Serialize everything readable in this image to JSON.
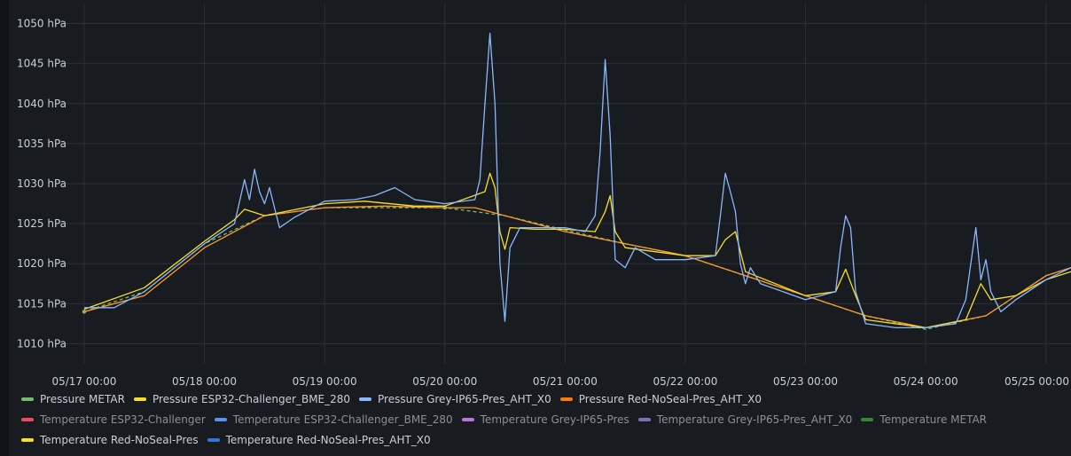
{
  "chart_data": {
    "type": "line",
    "y_unit": "hPa",
    "ylim": [
      1007.5,
      1052.5
    ],
    "y_ticks": [
      "1010 hPa",
      "1015 hPa",
      "1020 hPa",
      "1025 hPa",
      "1030 hPa",
      "1035 hPa",
      "1040 hPa",
      "1045 hPa",
      "1050 hPa"
    ],
    "y_tick_values": [
      1010,
      1015,
      1020,
      1025,
      1030,
      1035,
      1040,
      1045,
      1050
    ],
    "x_range": [
      "2024-05-16T21:00",
      "2024-05-25T05:00"
    ],
    "x_ticks": [
      "05/17 00:00",
      "05/18 00:00",
      "05/19 00:00",
      "05/20 00:00",
      "05/21 00:00",
      "05/22 00:00",
      "05/23 00:00",
      "05/24 00:00",
      "05/25 00:00"
    ],
    "grid": true,
    "legend_position": "bottom",
    "series": [
      {
        "name": "Pressure METAR",
        "color": "#73bf69",
        "style": "dashed",
        "points": [
          [
            "2024-05-17T00:00",
            1014.0
          ],
          [
            "2024-05-17T12:00",
            1016.5
          ],
          [
            "2024-05-18T00:00",
            1022.5
          ],
          [
            "2024-05-18T12:00",
            1026.0
          ],
          [
            "2024-05-19T00:00",
            1027.0
          ],
          [
            "2024-05-19T12:00",
            1027.0
          ],
          [
            "2024-05-20T00:00",
            1027.0
          ],
          [
            "2024-05-20T12:00",
            1026.0
          ],
          [
            "2024-05-21T00:00",
            1024.2
          ],
          [
            "2024-05-21T12:00",
            1022.5
          ],
          [
            "2024-05-22T00:00",
            1021.0
          ],
          [
            "2024-05-22T12:00",
            1018.5
          ],
          [
            "2024-05-23T00:00",
            1016.0
          ],
          [
            "2024-05-23T12:00",
            1013.5
          ],
          [
            "2024-05-24T00:00",
            1011.8
          ],
          [
            "2024-05-24T12:00",
            1013.5
          ],
          [
            "2024-05-25T00:00",
            1018.5
          ],
          [
            "2024-05-25T05:00",
            1019.5
          ]
        ]
      },
      {
        "name": "Pressure ESP32-Challenger_BME_280",
        "color": "#fade2a",
        "style": "solid",
        "points": [
          [
            "2024-05-17T00:00",
            1014.3
          ],
          [
            "2024-05-17T12:00",
            1017.0
          ],
          [
            "2024-05-18T00:00",
            1022.8
          ],
          [
            "2024-05-18T06:00",
            1025.5
          ],
          [
            "2024-05-18T08:00",
            1026.8
          ],
          [
            "2024-05-18T12:00",
            1026.0
          ],
          [
            "2024-05-19T00:00",
            1027.5
          ],
          [
            "2024-05-19T08:00",
            1027.8
          ],
          [
            "2024-05-19T18:00",
            1027.2
          ],
          [
            "2024-05-20T00:00",
            1027.2
          ],
          [
            "2024-05-20T08:00",
            1029.0
          ],
          [
            "2024-05-20T09:00",
            1031.3
          ],
          [
            "2024-05-20T10:00",
            1029.5
          ],
          [
            "2024-05-20T11:00",
            1024.0
          ],
          [
            "2024-05-20T12:00",
            1021.8
          ],
          [
            "2024-05-20T13:00",
            1024.5
          ],
          [
            "2024-05-20T18:00",
            1024.3
          ],
          [
            "2024-05-21T00:00",
            1024.3
          ],
          [
            "2024-05-21T06:00",
            1024.0
          ],
          [
            "2024-05-21T08:00",
            1026.5
          ],
          [
            "2024-05-21T09:00",
            1028.5
          ],
          [
            "2024-05-21T10:00",
            1024.0
          ],
          [
            "2024-05-21T12:00",
            1022.0
          ],
          [
            "2024-05-21T18:00",
            1021.5
          ],
          [
            "2024-05-22T00:00",
            1021.0
          ],
          [
            "2024-05-22T06:00",
            1021.0
          ],
          [
            "2024-05-22T08:00",
            1023.0
          ],
          [
            "2024-05-22T10:00",
            1024.0
          ],
          [
            "2024-05-22T12:00",
            1019.0
          ],
          [
            "2024-05-22T14:00",
            1018.5
          ],
          [
            "2024-05-23T00:00",
            1016.0
          ],
          [
            "2024-05-23T06:00",
            1016.5
          ],
          [
            "2024-05-23T08:00",
            1019.3
          ],
          [
            "2024-05-23T10:00",
            1016.0
          ],
          [
            "2024-05-23T12:00",
            1013.0
          ],
          [
            "2024-05-24T00:00",
            1012.0
          ],
          [
            "2024-05-24T08:00",
            1013.0
          ],
          [
            "2024-05-24T10:00",
            1016.0
          ],
          [
            "2024-05-24T11:00",
            1017.5
          ],
          [
            "2024-05-24T13:00",
            1015.5
          ],
          [
            "2024-05-24T18:00",
            1016.0
          ],
          [
            "2024-05-25T00:00",
            1018.0
          ],
          [
            "2024-05-25T05:00",
            1019.0
          ]
        ]
      },
      {
        "name": "Pressure Grey-IP65-Pres_AHT_X0",
        "color": "#8ab8ff",
        "style": "solid",
        "points": [
          [
            "2024-05-17T00:00",
            1014.5
          ],
          [
            "2024-05-17T06:00",
            1014.5
          ],
          [
            "2024-05-17T12:00",
            1016.5
          ],
          [
            "2024-05-18T00:00",
            1022.5
          ],
          [
            "2024-05-18T06:00",
            1025.0
          ],
          [
            "2024-05-18T08:00",
            1030.5
          ],
          [
            "2024-05-18T09:00",
            1028.0
          ],
          [
            "2024-05-18T10:00",
            1031.8
          ],
          [
            "2024-05-18T11:00",
            1029.0
          ],
          [
            "2024-05-18T12:00",
            1027.5
          ],
          [
            "2024-05-18T13:00",
            1029.5
          ],
          [
            "2024-05-18T14:00",
            1027.0
          ],
          [
            "2024-05-18T15:00",
            1024.5
          ],
          [
            "2024-05-18T18:00",
            1025.8
          ],
          [
            "2024-05-19T00:00",
            1027.8
          ],
          [
            "2024-05-19T06:00",
            1028.0
          ],
          [
            "2024-05-19T10:00",
            1028.5
          ],
          [
            "2024-05-19T14:00",
            1029.5
          ],
          [
            "2024-05-19T18:00",
            1028.0
          ],
          [
            "2024-05-20T00:00",
            1027.5
          ],
          [
            "2024-05-20T06:00",
            1028.0
          ],
          [
            "2024-05-20T07:00",
            1030.5
          ],
          [
            "2024-05-20T08:00",
            1040.0
          ],
          [
            "2024-05-20T09:00",
            1048.8
          ],
          [
            "2024-05-20T10:00",
            1040.0
          ],
          [
            "2024-05-20T11:00",
            1020.0
          ],
          [
            "2024-05-20T12:00",
            1012.8
          ],
          [
            "2024-05-20T13:00",
            1022.0
          ],
          [
            "2024-05-20T15:00",
            1024.5
          ],
          [
            "2024-05-20T18:00",
            1024.5
          ],
          [
            "2024-05-21T00:00",
            1024.5
          ],
          [
            "2024-05-21T04:00",
            1024.0
          ],
          [
            "2024-05-21T06:00",
            1026.0
          ],
          [
            "2024-05-21T07:00",
            1034.0
          ],
          [
            "2024-05-21T08:00",
            1045.5
          ],
          [
            "2024-05-21T09:00",
            1036.0
          ],
          [
            "2024-05-21T10:00",
            1020.5
          ],
          [
            "2024-05-21T12:00",
            1019.5
          ],
          [
            "2024-05-21T14:00",
            1022.0
          ],
          [
            "2024-05-21T18:00",
            1020.5
          ],
          [
            "2024-05-22T00:00",
            1020.5
          ],
          [
            "2024-05-22T06:00",
            1021.0
          ],
          [
            "2024-05-22T07:00",
            1026.0
          ],
          [
            "2024-05-22T08:00",
            1031.3
          ],
          [
            "2024-05-22T09:00",
            1029.0
          ],
          [
            "2024-05-22T10:00",
            1026.5
          ],
          [
            "2024-05-22T11:00",
            1020.0
          ],
          [
            "2024-05-22T12:00",
            1017.5
          ],
          [
            "2024-05-22T13:00",
            1019.5
          ],
          [
            "2024-05-22T15:00",
            1017.5
          ],
          [
            "2024-05-23T00:00",
            1015.5
          ],
          [
            "2024-05-23T06:00",
            1016.5
          ],
          [
            "2024-05-23T07:00",
            1022.0
          ],
          [
            "2024-05-23T08:00",
            1026.0
          ],
          [
            "2024-05-23T09:00",
            1024.5
          ],
          [
            "2024-05-23T10:00",
            1016.5
          ],
          [
            "2024-05-23T12:00",
            1012.5
          ],
          [
            "2024-05-23T18:00",
            1012.0
          ],
          [
            "2024-05-24T00:00",
            1012.0
          ],
          [
            "2024-05-24T06:00",
            1012.5
          ],
          [
            "2024-05-24T08:00",
            1015.5
          ],
          [
            "2024-05-24T09:00",
            1020.0
          ],
          [
            "2024-05-24T10:00",
            1024.5
          ],
          [
            "2024-05-24T11:00",
            1018.0
          ],
          [
            "2024-05-24T12:00",
            1020.5
          ],
          [
            "2024-05-24T13:00",
            1016.5
          ],
          [
            "2024-05-24T15:00",
            1014.0
          ],
          [
            "2024-05-24T18:00",
            1015.5
          ],
          [
            "2024-05-25T00:00",
            1018.0
          ],
          [
            "2024-05-25T05:00",
            1019.5
          ]
        ]
      },
      {
        "name": "Pressure Red-NoSeal-Pres_AHT_X0",
        "color": "#ff9830",
        "style": "solid",
        "points": [
          [
            "2024-05-17T00:00",
            1014.0
          ],
          [
            "2024-05-17T12:00",
            1016.0
          ],
          [
            "2024-05-18T00:00",
            1022.0
          ],
          [
            "2024-05-18T12:00",
            1026.0
          ],
          [
            "2024-05-19T00:00",
            1027.0
          ],
          [
            "2024-05-19T12:00",
            1027.2
          ],
          [
            "2024-05-20T00:00",
            1027.0
          ],
          [
            "2024-05-20T06:00",
            1027.0
          ],
          [
            "2024-05-20T12:00",
            1026.0
          ],
          [
            "2024-05-21T00:00",
            1024.0
          ],
          [
            "2024-05-21T12:00",
            1022.5
          ],
          [
            "2024-05-22T00:00",
            1021.0
          ],
          [
            "2024-05-22T12:00",
            1018.5
          ],
          [
            "2024-05-23T00:00",
            1016.0
          ],
          [
            "2024-05-23T12:00",
            1013.5
          ],
          [
            "2024-05-24T00:00",
            1012.0
          ],
          [
            "2024-05-24T12:00",
            1013.5
          ],
          [
            "2024-05-25T00:00",
            1018.5
          ],
          [
            "2024-05-25T05:00",
            1019.5
          ]
        ]
      }
    ],
    "legend": [
      {
        "name": "Pressure METAR",
        "color": "#73bf69",
        "dim": false
      },
      {
        "name": "Pressure ESP32-Challenger_BME_280",
        "color": "#fade2a",
        "dim": false
      },
      {
        "name": "Pressure Grey-IP65-Pres_AHT_X0",
        "color": "#8ab8ff",
        "dim": false
      },
      {
        "name": "Pressure Red-NoSeal-Pres_AHT_X0",
        "color": "#ff780a",
        "dim": false
      },
      {
        "name": "Temperature ESP32-Challenger",
        "color": "#f2495c",
        "dim": true
      },
      {
        "name": "Temperature ESP32-Challenger_BME_280",
        "color": "#5794f2",
        "dim": true
      },
      {
        "name": "Temperature Grey-IP65-Pres",
        "color": "#b877d9",
        "dim": true
      },
      {
        "name": "Temperature Grey-IP65-Pres_AHT_X0",
        "color": "#806eb7",
        "dim": true
      },
      {
        "name": "Temperature METAR",
        "color": "#37872d",
        "dim": true
      },
      {
        "name": "Temperature Red-NoSeal-Pres",
        "color": "#fade2a",
        "dim": false
      },
      {
        "name": "Temperature Red-NoSeal-Pres_AHT_X0",
        "color": "#3274d9",
        "dim": false
      }
    ]
  }
}
